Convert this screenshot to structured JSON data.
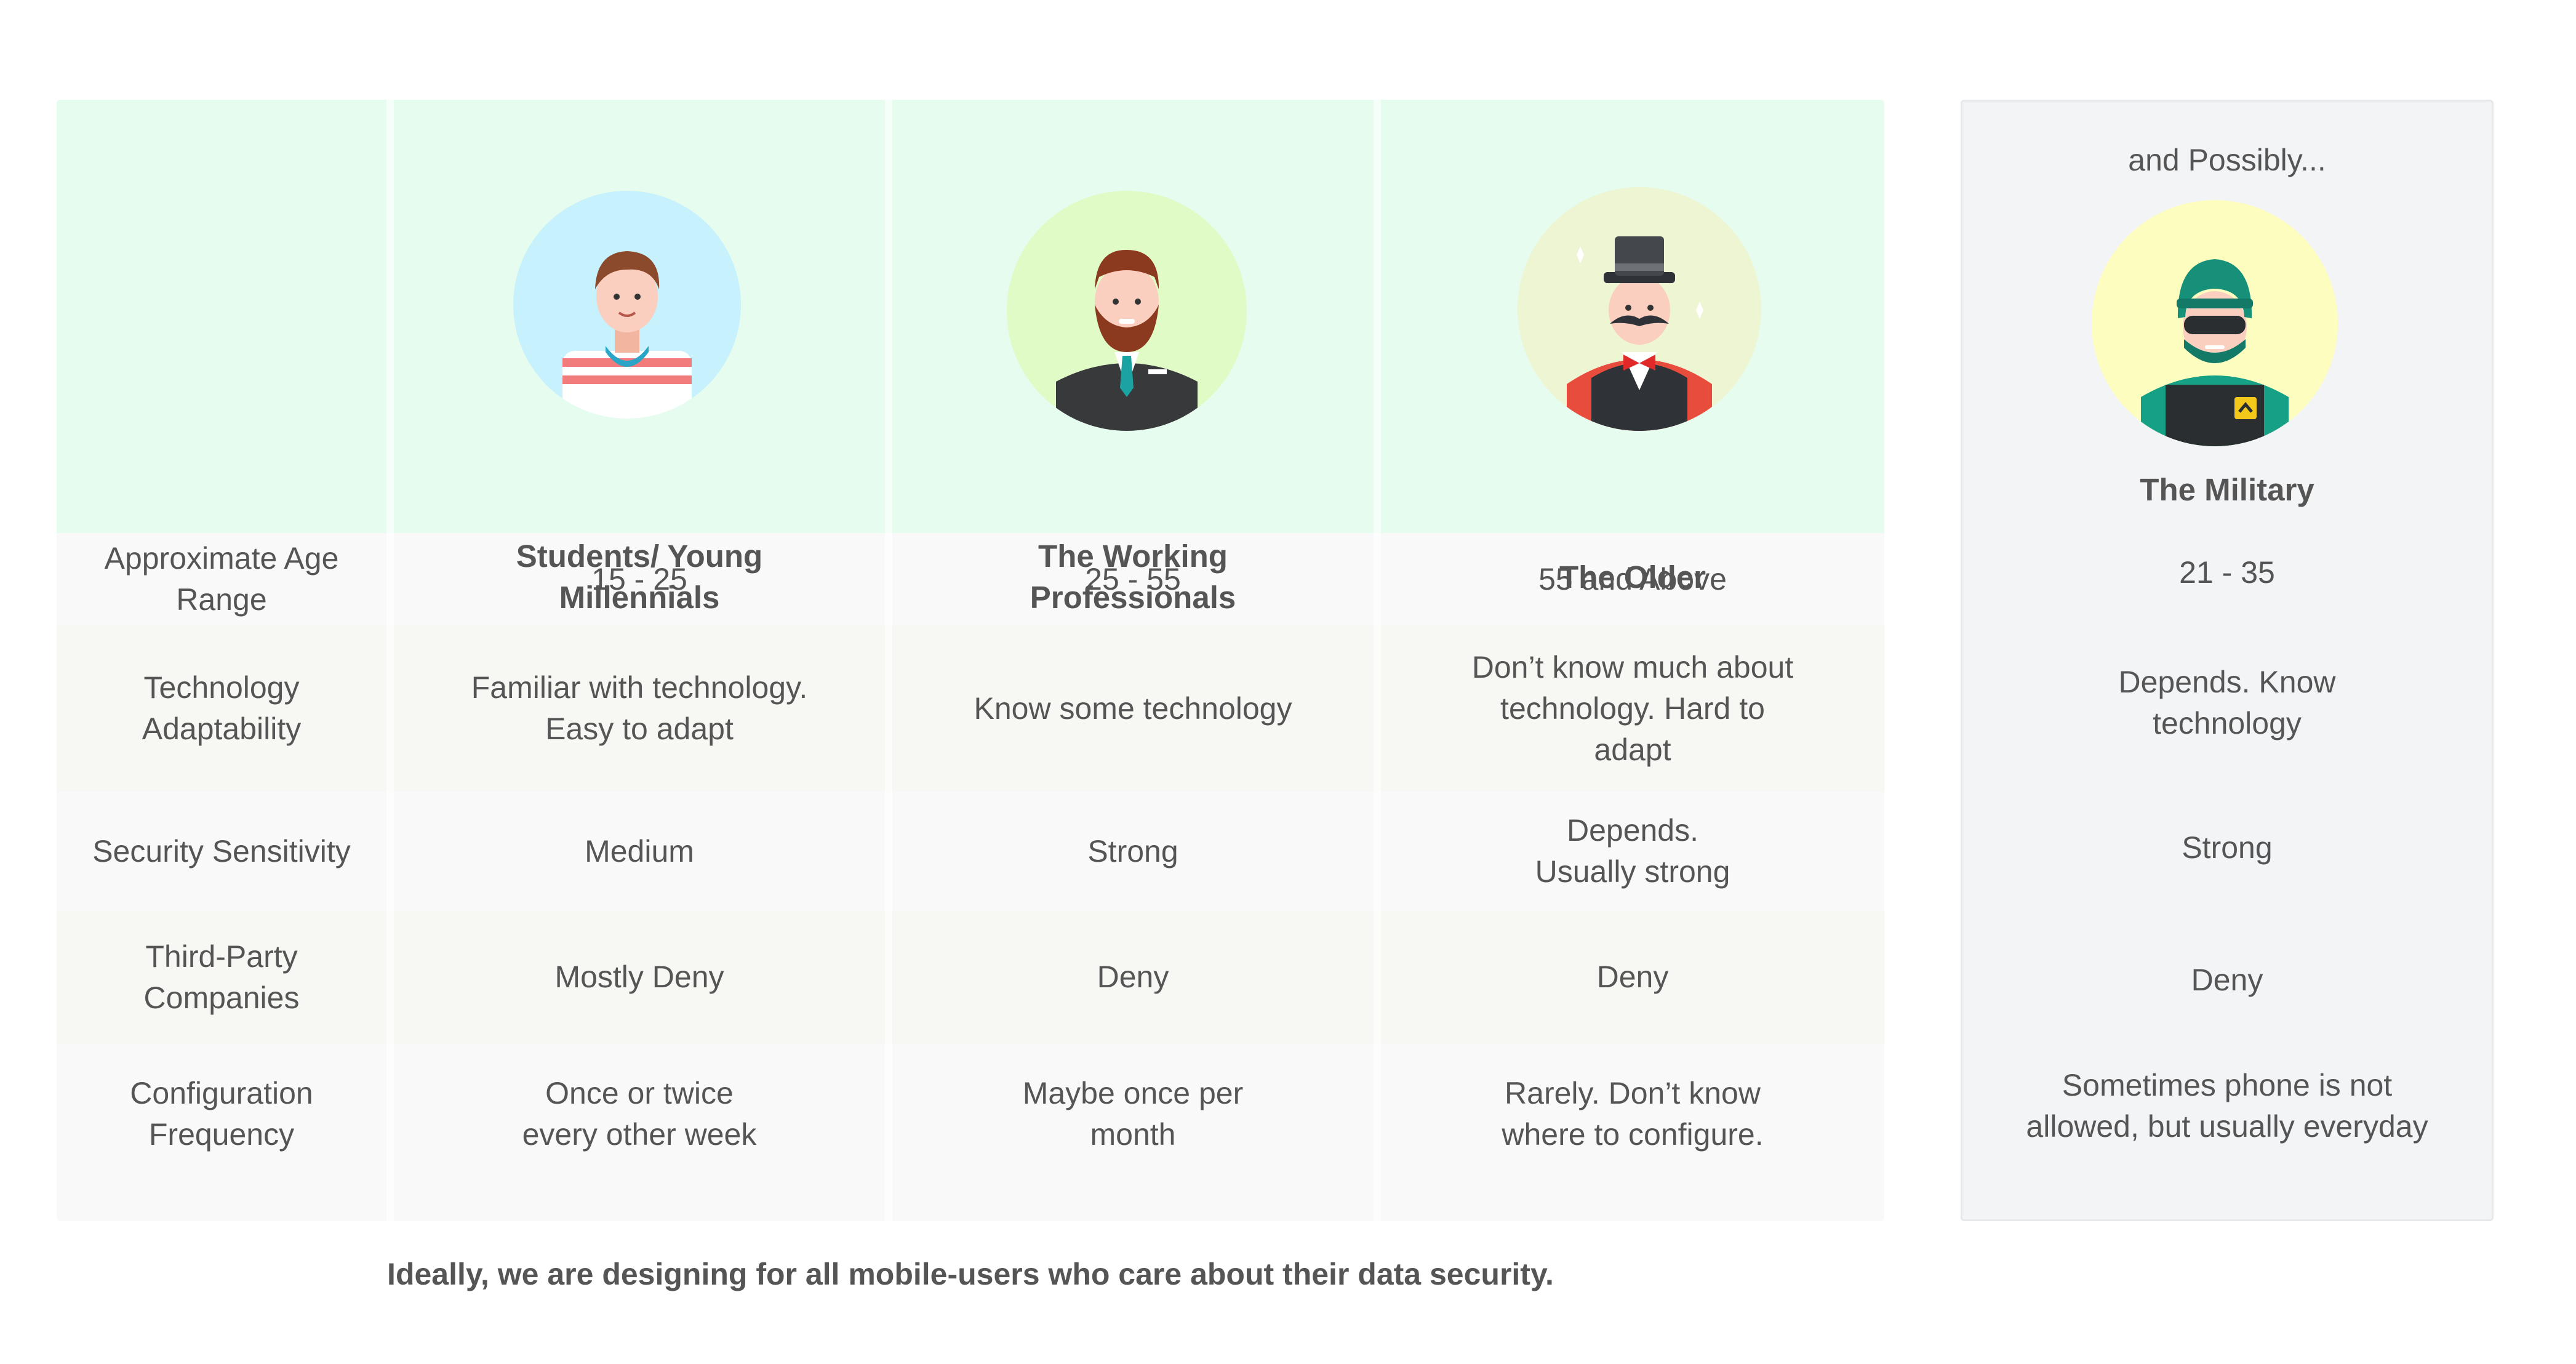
{
  "segments": [
    {
      "key": "students",
      "title": "Students/ Young\nMillennials",
      "icon": "student-avatar-icon"
    },
    {
      "key": "working",
      "title": "The Working\nProfessionals",
      "icon": "professional-avatar-icon"
    },
    {
      "key": "older",
      "title": "The Older",
      "icon": "older-gentleman-avatar-icon"
    }
  ],
  "military": {
    "heading": "and Possibly...",
    "title": "The Military",
    "icon": "military-soldier-avatar-icon",
    "values": {
      "age": "21 - 35",
      "tech": "Depends. Know\ntechnology",
      "security": "Strong",
      "third_party": "Deny",
      "config": "Sometimes phone is not\nallowed, but usually everyday"
    }
  },
  "rows": [
    {
      "key": "age",
      "label": "Approximate Age\nRange",
      "values": [
        "15 - 25",
        "25 - 55",
        "55 and Above"
      ]
    },
    {
      "key": "tech",
      "label": "Technology\nAdaptability",
      "values": [
        "Familiar with technology.\nEasy to adapt",
        "Know some technology",
        "Don’t know much about\ntechnology. Hard to\nadapt"
      ]
    },
    {
      "key": "security",
      "label": "Security Sensitivity",
      "values": [
        "Medium",
        "Strong",
        "Depends.\nUsually strong"
      ]
    },
    {
      "key": "third_party",
      "label": "Third-Party\nCompanies",
      "values": [
        "Mostly Deny",
        "Deny",
        "Deny"
      ]
    },
    {
      "key": "config",
      "label": "Configuration\nFrequency",
      "values": [
        "Once or twice\nevery other week",
        "Maybe once per\nmonth",
        "Rarely. Don’t know\nwhere to configure."
      ]
    }
  ],
  "footer": "Ideally, we are designing for all mobile-users who care about their data security.",
  "colors": {
    "header_band": "#e5fcee",
    "side_panel": "#f3f4f6",
    "student_circle": "#c6f1fd",
    "professional_circle": "#e0fbc6",
    "older_circle": "#eef5d2",
    "military_circle": "#fdfdbf"
  }
}
